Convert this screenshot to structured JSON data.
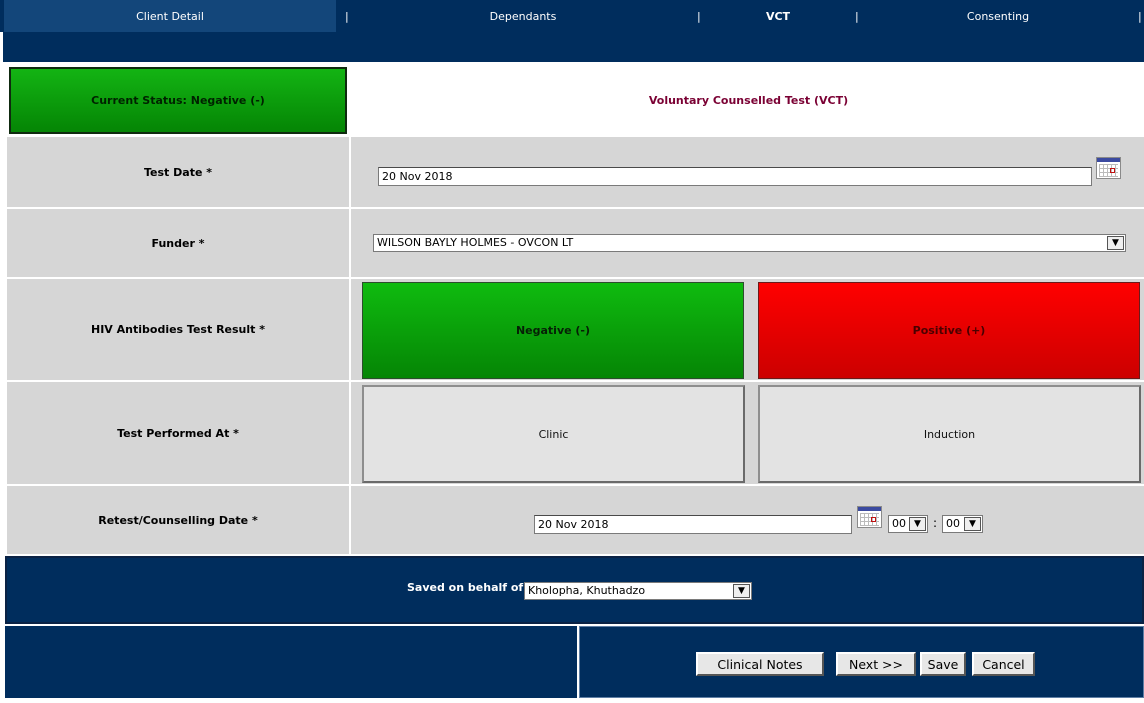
{
  "nav": {
    "tabs": [
      {
        "label": "Client Detail"
      },
      {
        "label": "Dependants"
      },
      {
        "label": "VCT"
      },
      {
        "label": "Consenting"
      }
    ],
    "separator": "|"
  },
  "header": {
    "status": "Current Status: Negative (-)",
    "title": "Voluntary Counselled Test (VCT)"
  },
  "form": {
    "test_date": {
      "label": "Test Date *",
      "value": "20 Nov 2018"
    },
    "funder": {
      "label": "Funder *",
      "value": "WILSON BAYLY HOLMES - OVCON LT"
    },
    "hiv_result": {
      "label": "HIV Antibodies Test Result *",
      "negative": "Negative (-)",
      "positive": "Positive (+)"
    },
    "performed_at": {
      "label": "Test Performed At *",
      "clinic": "Clinic",
      "induction": "Induction"
    },
    "retest": {
      "label": "Retest/Counselling Date *",
      "date": "20 Nov 2018",
      "hour": "00",
      "minute": "00",
      "time_sep": ":"
    }
  },
  "footer": {
    "on_behalf_label": "Saved on behalf of:",
    "on_behalf_value": "Kholopha, Khuthadzo",
    "buttons": {
      "clinical_notes": "Clinical Notes",
      "next": "Next >>",
      "save": "Save",
      "cancel": "Cancel"
    }
  },
  "colors": {
    "navy": "#002d5d",
    "negative_green": "#058505",
    "positive_red": "#ff0000",
    "title_text": "#7a0033",
    "cell_gray": "#d6d6d6"
  },
  "icons": [
    "calendar-icon",
    "dropdown-arrow-icon"
  ]
}
